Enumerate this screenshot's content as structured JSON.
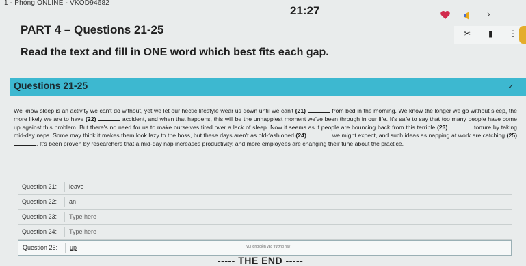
{
  "header": {
    "room": "1 - Phòng ONLINE - VKOD94682",
    "timer": "21:27"
  },
  "part": {
    "title": "PART 4 – Questions 21-25",
    "instruction": "Read the text and fill in ONE word which best fits each gap."
  },
  "section": {
    "title": "Questions 21-25"
  },
  "passage": {
    "s1": "We know sleep is an activity we can't do without, yet we let our hectic lifestyle wear us down until we can't ",
    "n21": "(21)",
    "s2": " from bed in the morning. We know the longer we go without sleep, the more likely we are to have ",
    "n22": "(22)",
    "s3": " accident, and when that happens, this will be the unhappiest moment we've been through in our life. It's safe to say that too many people have come up against this problem. But there's no need for us to make ourselves tired over a lack of sleep. Now it seems as if people are bouncing back from this terrible ",
    "n23": "(23)",
    "s4": " torture by taking mid-day naps. Some may think it makes them look lazy to the boss, but these days aren't as old-fashioned ",
    "n24": "(24)",
    "s5": " we might expect, and such ideas as napping at work are catching ",
    "n25": "(25)",
    "s6": ". It's been proven by researchers that a mid-day nap increases productivity, and more employees are changing their tune about the practice."
  },
  "answers": [
    {
      "label": "Question 21:",
      "value": "leave"
    },
    {
      "label": "Question 22:",
      "value": "an"
    },
    {
      "label": "Question 23:",
      "value": "Type here"
    },
    {
      "label": "Question 24:",
      "value": "Type here"
    },
    {
      "label": "Question 25:",
      "value": "up"
    }
  ],
  "hint": "Vui lòng điền vào trường này",
  "footer": {
    "end": "----- THE END -----"
  },
  "colors": {
    "banner": "#3db8d0",
    "accent": "#e4ad2b"
  },
  "icons": [
    "heart-icon",
    "megaphone-icon",
    "chevron-right-icon",
    "mic-off-icon",
    "screen-icon",
    "more-icon"
  ]
}
